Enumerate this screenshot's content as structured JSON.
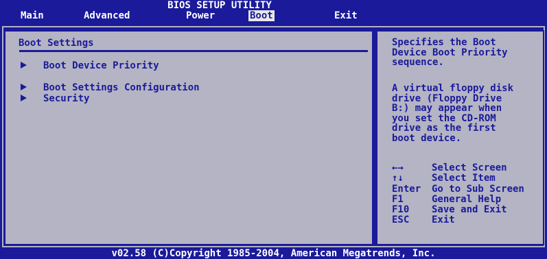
{
  "header": {
    "title": "BIOS SETUP UTILITY"
  },
  "menu": {
    "items": [
      "Main",
      "Advanced",
      "Power",
      "Boot",
      "Exit"
    ],
    "active": "Boot"
  },
  "main": {
    "section_title": "Boot Settings",
    "items": [
      "Boot Device Priority",
      "Boot Settings Configuration",
      "Security"
    ]
  },
  "help": {
    "description_1": "Specifies the Boot\nDevice Boot Priority\nsequence.",
    "description_2": "A virtual floppy disk\ndrive (Floppy Drive\nB:) may appear when\nyou set the CD-ROM\ndrive as the first\nboot device.",
    "keys": [
      {
        "key": "←→",
        "action": "Select Screen"
      },
      {
        "key": "↑↓",
        "action": "Select Item"
      },
      {
        "key": "Enter",
        "action": "Go to Sub Screen"
      },
      {
        "key": "F1",
        "action": "General Help"
      },
      {
        "key": "F10",
        "action": "Save and Exit"
      },
      {
        "key": "ESC",
        "action": "Exit"
      }
    ]
  },
  "footer": {
    "text": "v02.58 (C)Copyright 1985-2004, American Megatrends, Inc."
  },
  "colors": {
    "background": "#1a1a9a",
    "panel": "#b4b4c4",
    "text_panel": "#1a1a9a",
    "text_header": "#ffffff"
  }
}
